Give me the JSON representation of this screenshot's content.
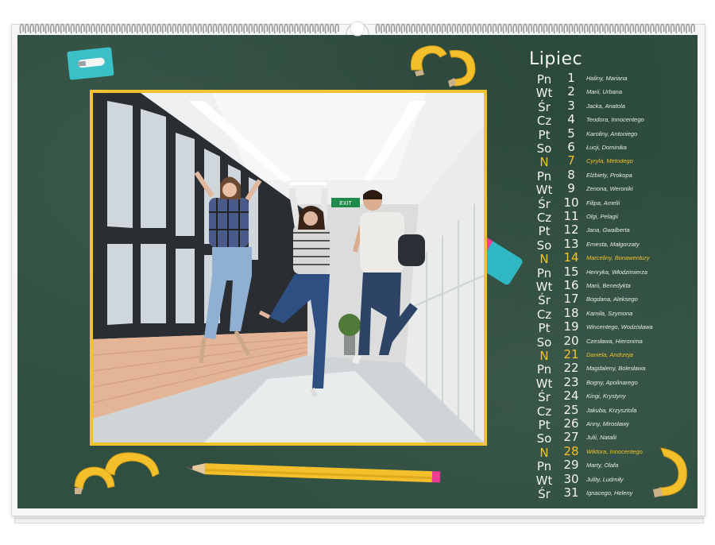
{
  "calendar": {
    "month": "Lipiec",
    "sunday_color": "#f3c02c",
    "board_color": "#2f4f40",
    "frame_color": "#f2c230",
    "days": [
      {
        "dow": "Pn",
        "num": "1",
        "names": "Haliny, Mariana",
        "sunday": false
      },
      {
        "dow": "Wt",
        "num": "2",
        "names": "Marii, Urbana",
        "sunday": false
      },
      {
        "dow": "Śr",
        "num": "3",
        "names": "Jacka, Anatola",
        "sunday": false
      },
      {
        "dow": "Cz",
        "num": "4",
        "names": "Teodora, Innocentego",
        "sunday": false
      },
      {
        "dow": "Pt",
        "num": "5",
        "names": "Karoliny, Antoniego",
        "sunday": false
      },
      {
        "dow": "So",
        "num": "6",
        "names": "Łucji, Dominika",
        "sunday": false
      },
      {
        "dow": "N",
        "num": "7",
        "names": "Cyryla, Metodego",
        "sunday": true
      },
      {
        "dow": "Pn",
        "num": "8",
        "names": "Elżbiety, Prokopa",
        "sunday": false
      },
      {
        "dow": "Wt",
        "num": "9",
        "names": "Zenona, Weroniki",
        "sunday": false
      },
      {
        "dow": "Śr",
        "num": "10",
        "names": "Filipa, Amelii",
        "sunday": false
      },
      {
        "dow": "Cz",
        "num": "11",
        "names": "Olgi, Pelagii",
        "sunday": false
      },
      {
        "dow": "Pt",
        "num": "12",
        "names": "Jana, Gwalberta",
        "sunday": false
      },
      {
        "dow": "So",
        "num": "13",
        "names": "Ernesta, Małgorzaty",
        "sunday": false
      },
      {
        "dow": "N",
        "num": "14",
        "names": "Marceliny, Bonawentury",
        "sunday": true
      },
      {
        "dow": "Pn",
        "num": "15",
        "names": "Henryka, Włodzimierza",
        "sunday": false
      },
      {
        "dow": "Wt",
        "num": "16",
        "names": "Marii, Benedykta",
        "sunday": false
      },
      {
        "dow": "Śr",
        "num": "17",
        "names": "Bogdana, Aleksego",
        "sunday": false
      },
      {
        "dow": "Cz",
        "num": "18",
        "names": "Kamila, Szymona",
        "sunday": false
      },
      {
        "dow": "Pt",
        "num": "19",
        "names": "Wincentego, Wodzisława",
        "sunday": false
      },
      {
        "dow": "So",
        "num": "20",
        "names": "Czesława, Hieronima",
        "sunday": false
      },
      {
        "dow": "N",
        "num": "21",
        "names": "Daniela, Andrzeja",
        "sunday": true
      },
      {
        "dow": "Pn",
        "num": "22",
        "names": "Magdaleny, Bolesława",
        "sunday": false
      },
      {
        "dow": "Wt",
        "num": "23",
        "names": "Bogny, Apolinarego",
        "sunday": false
      },
      {
        "dow": "Śr",
        "num": "24",
        "names": "Kingi, Krystyny",
        "sunday": false
      },
      {
        "dow": "Cz",
        "num": "25",
        "names": "Jakuba, Krzysztofa",
        "sunday": false
      },
      {
        "dow": "Pt",
        "num": "26",
        "names": "Anny, Mirosławy",
        "sunday": false
      },
      {
        "dow": "So",
        "num": "27",
        "names": "Julii, Natalii",
        "sunday": false
      },
      {
        "dow": "N",
        "num": "28",
        "names": "Wiktora, Innocentego",
        "sunday": true
      },
      {
        "dow": "Pn",
        "num": "29",
        "names": "Marty, Olafa",
        "sunday": false
      },
      {
        "dow": "Wt",
        "num": "30",
        "names": "Julity, Ludmiły",
        "sunday": false
      },
      {
        "dow": "Śr",
        "num": "31",
        "names": "Ignacego, Heleny",
        "sunday": false
      }
    ]
  },
  "photo": {
    "exit_sign": "EXIT"
  },
  "decorations": {
    "icons": [
      "sharpener-icon",
      "pencil-shavings-icon",
      "eraser-icon",
      "pencil-icon",
      "spiral-binding-icon",
      "hanger-hook-icon"
    ]
  }
}
